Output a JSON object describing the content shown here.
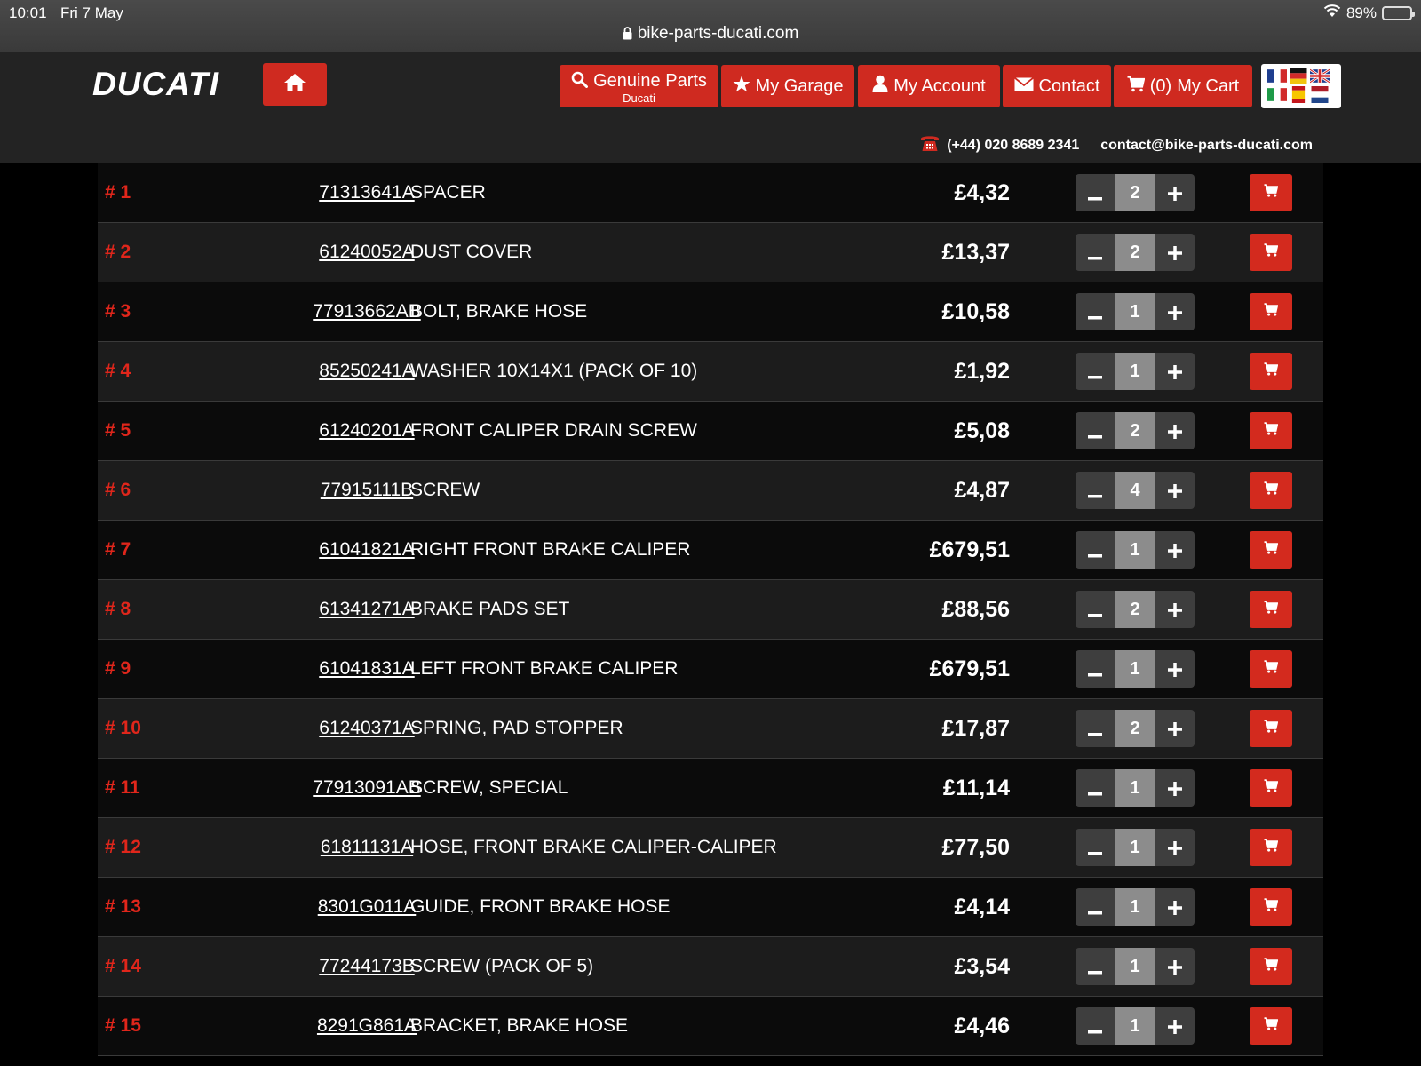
{
  "status_bar": {
    "time": "10:01",
    "date": "Fri 7 May",
    "battery_text": "89%",
    "battery_level": 0.89
  },
  "browser": {
    "url": "bike-parts-ducati.com"
  },
  "header": {
    "logo": "DUCATI",
    "nav": {
      "genuine_parts": "Genuine Parts",
      "genuine_parts_sub": "Ducati",
      "my_garage": "My Garage",
      "my_account": "My Account",
      "contact": "Contact",
      "cart_count": "(0)",
      "my_cart": "My Cart"
    },
    "phone": "(+44) 020 8689 2341",
    "email": "contact@bike-parts-ducati.com"
  },
  "colors": {
    "accent": "#cf2a20",
    "header_bg": "#232323",
    "row_odd": "#0b0b0b",
    "row_even": "#1c1c1c"
  },
  "parts": [
    {
      "num": "# 1",
      "ref": "71313641A",
      "desc": "SPACER",
      "price": "£4,32",
      "qty": "2"
    },
    {
      "num": "# 2",
      "ref": "61240052A",
      "desc": "DUST COVER",
      "price": "£13,37",
      "qty": "2"
    },
    {
      "num": "# 3",
      "ref": "77913662AB",
      "desc": "BOLT, BRAKE HOSE",
      "price": "£10,58",
      "qty": "1"
    },
    {
      "num": "# 4",
      "ref": "85250241A",
      "desc": "WASHER 10X14X1 (PACK OF 10)",
      "price": "£1,92",
      "qty": "1"
    },
    {
      "num": "# 5",
      "ref": "61240201A",
      "desc": "FRONT CALIPER DRAIN SCREW",
      "price": "£5,08",
      "qty": "2"
    },
    {
      "num": "# 6",
      "ref": "77915111B",
      "desc": "SCREW",
      "price": "£4,87",
      "qty": "4"
    },
    {
      "num": "# 7",
      "ref": "61041821A",
      "desc": "RIGHT FRONT BRAKE CALIPER",
      "price": "£679,51",
      "qty": "1"
    },
    {
      "num": "# 8",
      "ref": "61341271A",
      "desc": "BRAKE PADS SET",
      "price": "£88,56",
      "qty": "2"
    },
    {
      "num": "# 9",
      "ref": "61041831A",
      "desc": "LEFT FRONT BRAKE CALIPER",
      "price": "£679,51",
      "qty": "1"
    },
    {
      "num": "# 10",
      "ref": "61240371A",
      "desc": "SPRING, PAD STOPPER",
      "price": "£17,87",
      "qty": "2"
    },
    {
      "num": "# 11",
      "ref": "77913091AB",
      "desc": "SCREW, SPECIAL",
      "price": "£11,14",
      "qty": "1"
    },
    {
      "num": "# 12",
      "ref": "61811131A",
      "desc": "HOSE, FRONT BRAKE CALIPER-CALIPER",
      "price": "£77,50",
      "qty": "1"
    },
    {
      "num": "# 13",
      "ref": "8301G011A",
      "desc": "GUIDE, FRONT BRAKE HOSE",
      "price": "£4,14",
      "qty": "1"
    },
    {
      "num": "# 14",
      "ref": "77244173B",
      "desc": "SCREW (PACK OF 5)",
      "price": "£3,54",
      "qty": "1"
    },
    {
      "num": "# 15",
      "ref": "8291G861A",
      "desc": "BRACKET, BRAKE HOSE",
      "price": "£4,46",
      "qty": "1"
    }
  ]
}
